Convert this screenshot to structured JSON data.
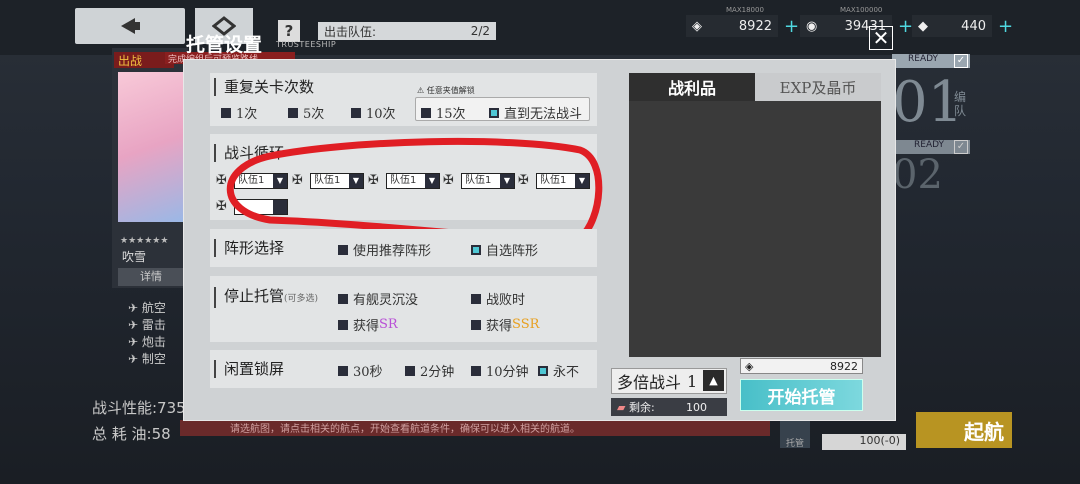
{
  "top": {
    "sortie_label": "出击队伍:",
    "sortie_count": "2/2",
    "res1_max": "MAX18000",
    "res1_value": "8922",
    "res2_max": "MAX100000",
    "res2_value": "39431",
    "res3_value": "440"
  },
  "left": {
    "sortie_tag": "出战",
    "banner": "完成编组后可预览路线",
    "stars": "★★★★★★",
    "girl_name": "吹雪",
    "detail": "详情",
    "skills": [
      "航空",
      "雷击",
      "炮击",
      "制空"
    ],
    "power_label": "战斗性能:735",
    "fuel_label": "总 耗 油:58",
    "hint": "请选航图，请点击相关的航点，开始查看航道条件，确保可以进入相关的航道。"
  },
  "right_bg": {
    "ready1": "READY",
    "ready2": "READY",
    "fleet1": "01",
    "fleet2": "02",
    "fleet1_side": "编队",
    "qihang": "起航",
    "tuoguan_small": "托管",
    "fuel_small": "100(-0)"
  },
  "dialog": {
    "title": "托管设置",
    "subtitle": "TRUSTEESHIP",
    "repeat": {
      "title": "重复关卡次数",
      "hint": "任意夹值解锁",
      "options": [
        "1次",
        "5次",
        "10次",
        "15次",
        "直到无法战斗"
      ]
    },
    "loop": {
      "title": "战斗循环",
      "fleets": [
        "队伍1",
        "队伍1",
        "队伍1",
        "队伍1",
        "队伍1"
      ]
    },
    "formation": {
      "title": "阵形选择",
      "opt1": "使用推荐阵形",
      "opt2": "自选阵形"
    },
    "stop": {
      "title": "停止托管",
      "sub": "(可多选)",
      "opt1": "有舰灵沉没",
      "opt2": "战败时",
      "opt3_pre": "获得",
      "opt3_rank": "SR",
      "opt4_pre": "获得",
      "opt4_rank": "SSR"
    },
    "idle": {
      "title": "闲置锁屏",
      "options": [
        "30秒",
        "2分钟",
        "10分钟",
        "永不"
      ]
    },
    "tabs": {
      "loot": "战利品",
      "exp": "EXP及晶币"
    },
    "multi_label": "多倍战斗",
    "multi_value": "1",
    "remain_label": "剩余:",
    "remain_value": "100",
    "cost_value": "8922",
    "start": "开始托管"
  },
  "colors": {
    "accent": "#4fc7d4",
    "sr": "#b84fd6",
    "ssr": "#e8a020",
    "annotation": "#e01e24"
  }
}
